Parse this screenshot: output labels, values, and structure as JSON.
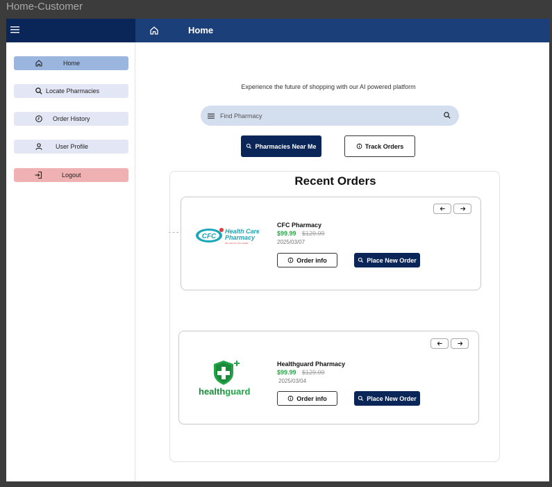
{
  "window": {
    "title": "Home-Customer"
  },
  "topbar": {
    "title": "Home"
  },
  "sidebar": {
    "items": [
      {
        "label": "Home"
      },
      {
        "label": "Locate Pharmacies"
      },
      {
        "label": "Order History"
      },
      {
        "label": "User Profile"
      },
      {
        "label": "Logout"
      }
    ]
  },
  "main": {
    "tagline": "Experience the future of shopping with our AI powered platform",
    "search": {
      "placeholder": "Find Pharmacy"
    },
    "actions": {
      "near_me": "Pharmacies Near Me",
      "track": "Track Orders"
    }
  },
  "recent_orders": {
    "title": "Recent Orders",
    "orders": [
      {
        "logo": {
          "badge": "CFC",
          "line1": "Health Care",
          "line2": "Pharmacy",
          "tagline": "We Care For Your Health"
        },
        "name": "CFC Pharmacy",
        "price": "$99.99",
        "old_price": "$129.99",
        "date": "2025/03/07",
        "info_label": "Order info",
        "reorder_label": "Place New Order"
      },
      {
        "logo": {
          "word1": "health",
          "word2": "guard"
        },
        "name": "Healthguard  Pharmacy",
        "price": "$99.99",
        "old_price": "$129.99",
        "date": "2025/03/04",
        "info_label": "Order info",
        "reorder_label": "Place New Order"
      }
    ]
  },
  "colors": {
    "navy": "#0a2558",
    "topbar_right": "#1b3f78",
    "active_nav": "#9ab5de",
    "nav": "#e3e6f4",
    "logout": "#efb1b1",
    "price_green": "#28a745"
  }
}
